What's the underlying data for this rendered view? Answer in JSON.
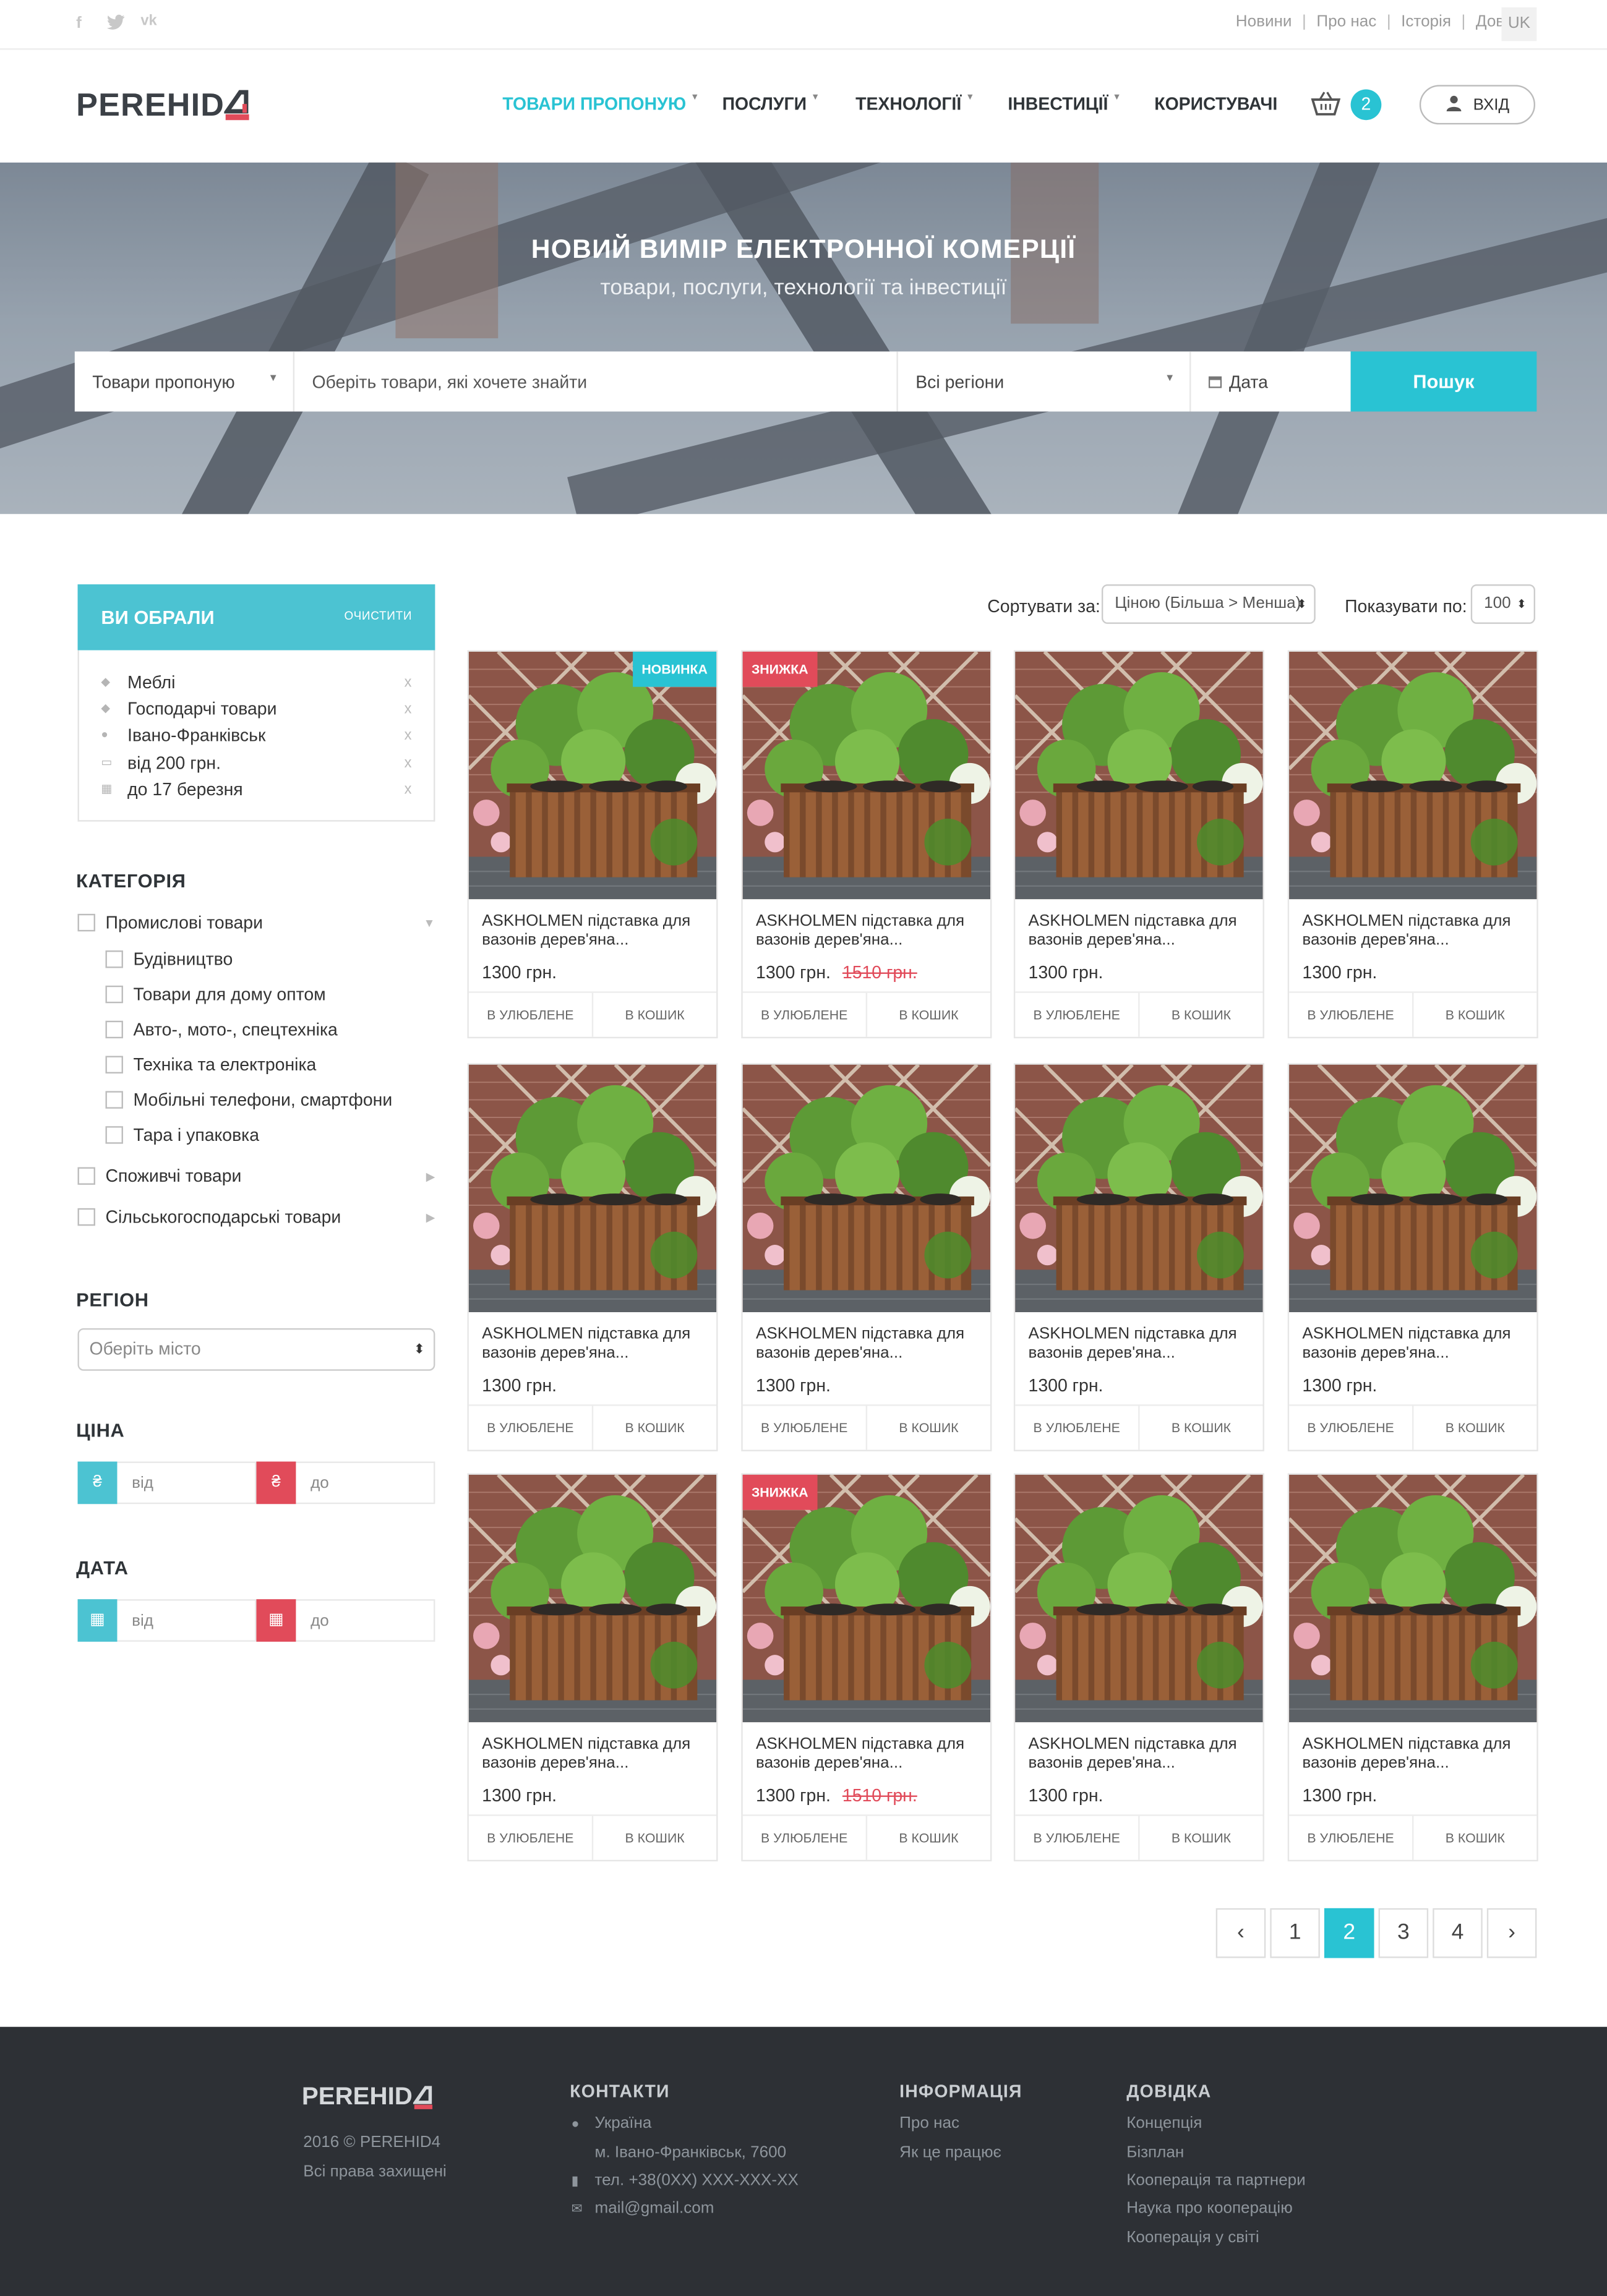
{
  "topbar": {
    "social": [
      "facebook-icon",
      "twitter-icon",
      "vk-icon"
    ],
    "links": [
      "Новини",
      "Про нас",
      "Історія",
      "Довідка"
    ],
    "lang": "UK"
  },
  "header": {
    "logo": "PEREHID",
    "logo_mark": "4",
    "nav": [
      {
        "label": "ТОВАРИ ПРОПОНУЮ",
        "active": true,
        "caret": "▼"
      },
      {
        "label": "ПОСЛУГИ",
        "caret": "▼"
      },
      {
        "label": "ТЕХНОЛОГІЇ",
        "caret": "▼"
      },
      {
        "label": "ІНВЕСТИЦІЇ",
        "caret": "▼"
      },
      {
        "label": "КОРИСТУВАЧІ"
      }
    ],
    "cart_count": "2",
    "login": "ВХІД"
  },
  "hero": {
    "title": "НОВИЙ ВИМІР ЕЛЕКТРОННОЇ КОМЕРЦІЇ",
    "subtitle": "товари, послуги, технології та інвестиції",
    "search": {
      "type": "Товари пропоную",
      "query_placeholder": "Оберіть товари, які хочете знайти",
      "region": "Всі регіони",
      "date": "Дата",
      "button": "Пошук"
    }
  },
  "chosen": {
    "title": "ВИ ОБРАЛИ",
    "clear": "ОЧИСТИТИ",
    "items": [
      {
        "label": "Меблі",
        "icon": "tag-icon"
      },
      {
        "label": "Господарчі товари",
        "icon": "tag-icon"
      },
      {
        "label": "Івано-Франківськ",
        "icon": "location-icon"
      },
      {
        "label": "від 200 грн.",
        "icon": "money-icon"
      },
      {
        "label": "до 17 березня",
        "icon": "calendar-icon"
      }
    ],
    "remove": "x"
  },
  "category": {
    "title": "КАТЕГОРІЯ",
    "items": [
      {
        "label": "Промислові товари",
        "level": 0,
        "open": true
      },
      {
        "label": "Будівництво",
        "level": 1
      },
      {
        "label": "Товари для дому оптом",
        "level": 1
      },
      {
        "label": "Авто-, мото-, спецтехніка",
        "level": 1
      },
      {
        "label": "Техніка та електроніка",
        "level": 1
      },
      {
        "label": "Мобільні телефони, смартфони",
        "level": 1
      },
      {
        "label": "Тара і упаковка",
        "level": 1
      },
      {
        "label": "Споживчі товари",
        "level": 0
      },
      {
        "label": "Сільськогосподарські товари",
        "level": 0
      }
    ]
  },
  "region": {
    "title": "РЕГІОН",
    "placeholder": "Оберіть місто"
  },
  "price_filter": {
    "title": "ЦІНА",
    "from": "від",
    "to": "до",
    "symbol": "₴"
  },
  "date_filter": {
    "title": "ДАТА",
    "from": "від",
    "to": "до"
  },
  "toolbar": {
    "sort_label": "Сортувати за:",
    "sort_value": "Ціною (Більша > Менша)",
    "show_label": "Показувати по:",
    "show_value": "100"
  },
  "products": [
    {
      "title": "ASKHOLMEN підставка для вазонів дерев'яна...",
      "price": "1300 грн.",
      "old": "",
      "tag": "НОВИНКА"
    },
    {
      "title": "ASKHOLMEN підставка для вазонів дерев'яна...",
      "price": "1300 грн.",
      "old": "1510 грн.",
      "tag": "ЗНИЖКА"
    },
    {
      "title": "ASKHOLMEN підставка для вазонів дерев'яна...",
      "price": "1300 грн.",
      "old": "",
      "tag": ""
    },
    {
      "title": "ASKHOLMEN підставка для вазонів дерев'яна...",
      "price": "1300 грн.",
      "old": "",
      "tag": ""
    },
    {
      "title": "ASKHOLMEN підставка для вазонів дерев'яна...",
      "price": "1300 грн.",
      "old": "",
      "tag": ""
    },
    {
      "title": "ASKHOLMEN підставка для вазонів дерев'яна...",
      "price": "1300 грн.",
      "old": "",
      "tag": ""
    },
    {
      "title": "ASKHOLMEN підставка для вазонів дерев'яна...",
      "price": "1300 грн.",
      "old": "",
      "tag": ""
    },
    {
      "title": "ASKHOLMEN підставка для вазонів дерев'яна...",
      "price": "1300 грн.",
      "old": "",
      "tag": ""
    },
    {
      "title": "ASKHOLMEN підставка для вазонів дерев'яна...",
      "price": "1300 грн.",
      "old": "",
      "tag": ""
    },
    {
      "title": "ASKHOLMEN підставка для вазонів дерев'яна...",
      "price": "1300 грн.",
      "old": "1510 грн.",
      "tag": "ЗНИЖКА"
    },
    {
      "title": "ASKHOLMEN підставка для вазонів дерев'яна...",
      "price": "1300 грн.",
      "old": "",
      "tag": ""
    },
    {
      "title": "ASKHOLMEN підставка для вазонів дерев'яна...",
      "price": "1300 грн.",
      "old": "",
      "tag": ""
    }
  ],
  "card_buttons": {
    "fav": "В УЛЮБЛЕНЕ",
    "cart": "В КОШИК"
  },
  "pagination": {
    "prev": "‹",
    "pages": [
      "1",
      "2",
      "3",
      "4"
    ],
    "current": "2",
    "next": "›"
  },
  "footer": {
    "logo": "PEREHID",
    "logo_mark": "4",
    "copy": "2016 © PEREHID4",
    "rights": "Всі права захищені",
    "contacts": {
      "title": "КОНТАКТИ",
      "country": "Україна",
      "city": "м. Івано-Франківськ, 7600",
      "phone": "тел. +38(0XX) XXX-XXX-XX",
      "email": "mail@gmail.com"
    },
    "info": {
      "title": "ІНФОРМАЦІЯ",
      "links": [
        "Про нас",
        "Як це працює"
      ]
    },
    "help": {
      "title": "ДОВІДКА",
      "links": [
        "Концепція",
        "Бізплан",
        "Кооперація та партнери",
        "Наука про кооперацію",
        "Кооперація у світі"
      ]
    }
  },
  "colors": {
    "accent": "#29c3d3",
    "sale": "#e14b5a",
    "footer_bg": "#2d3035"
  }
}
